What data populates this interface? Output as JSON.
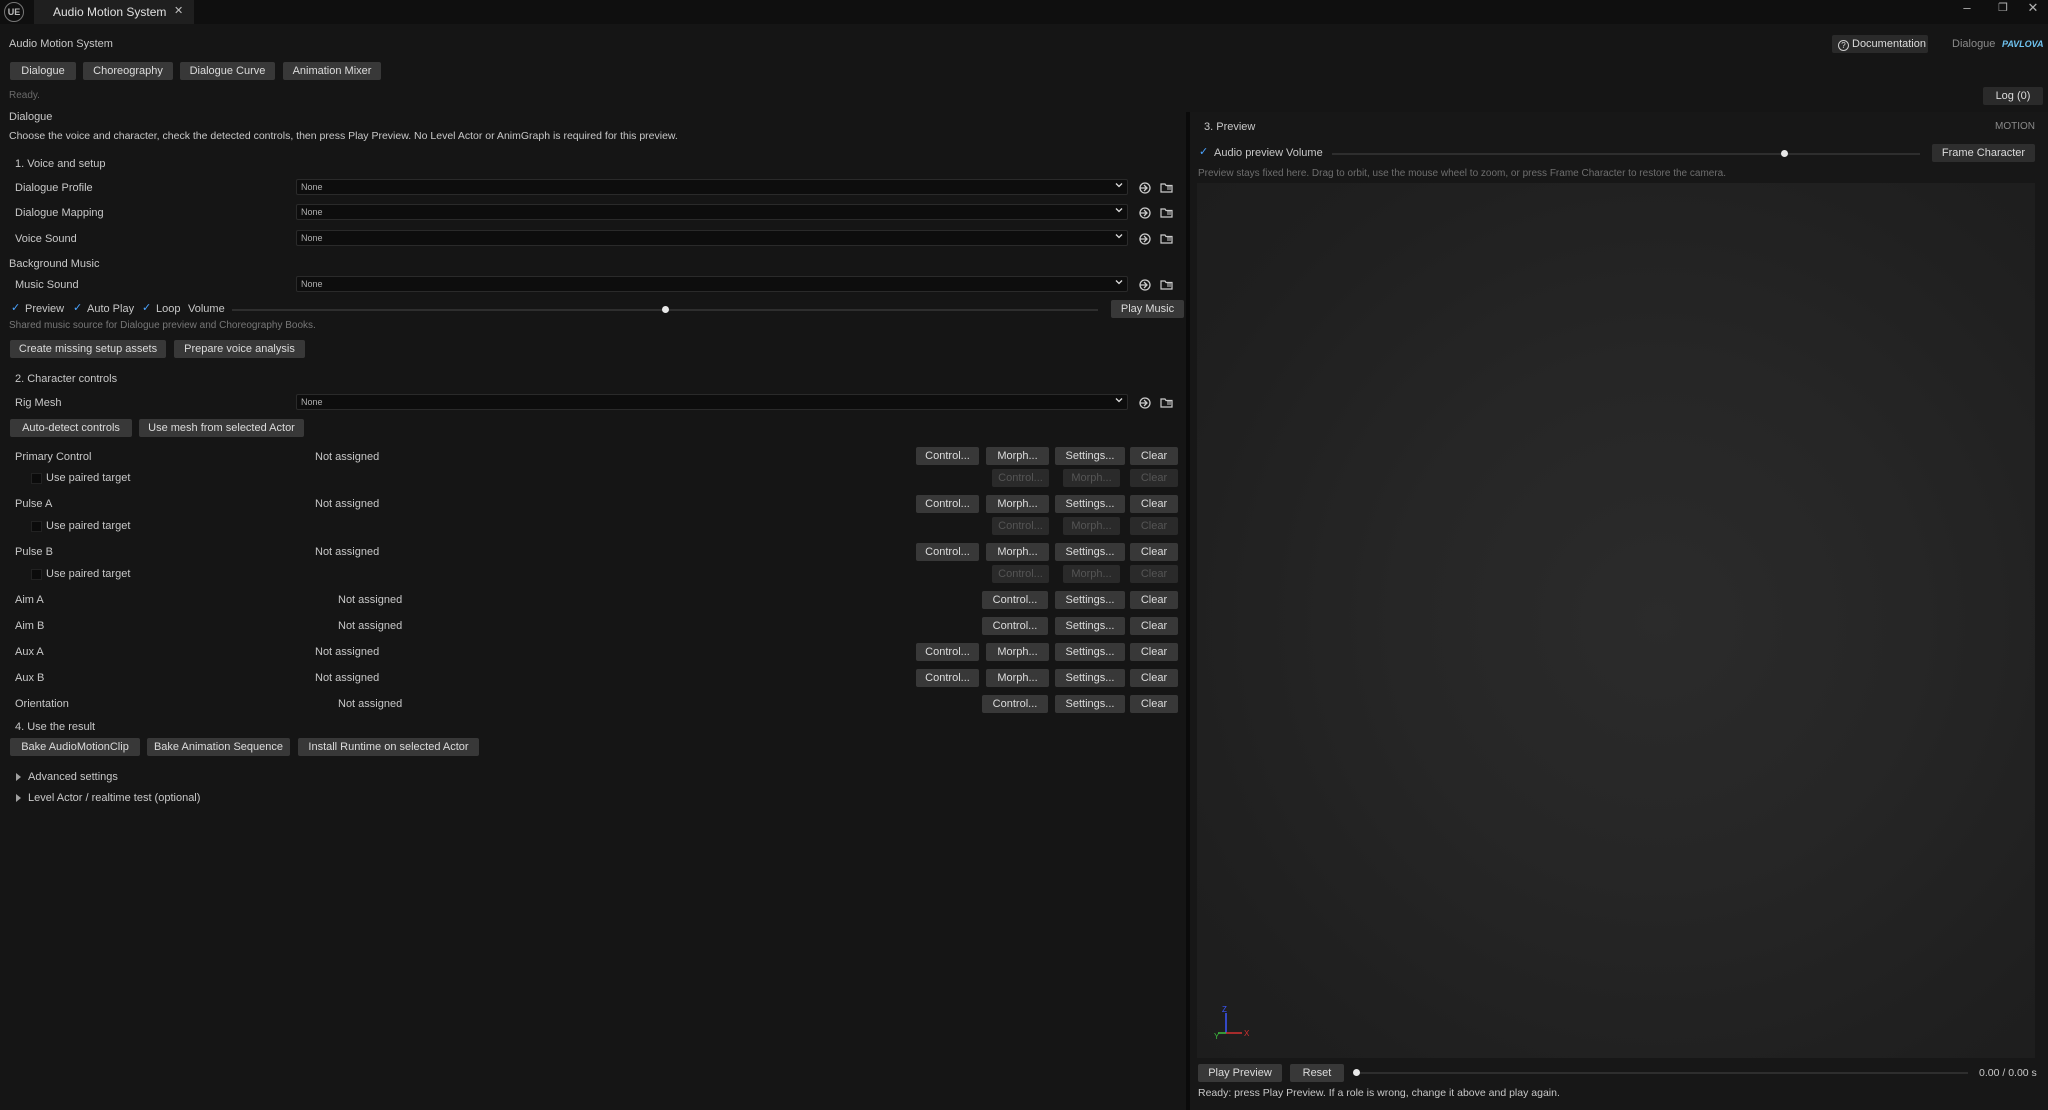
{
  "window": {
    "tab_title": "Audio Motion System",
    "close_glyph": "✕",
    "logo_text": "UE"
  },
  "header": {
    "title": "Audio Motion System",
    "documentation_label": "Documentation",
    "mode_label": "Dialogue",
    "brand_label": "PAVLOVA"
  },
  "mode_tabs": [
    "Dialogue",
    "Choreography",
    "Dialogue Curve",
    "Animation Mixer"
  ],
  "status": {
    "text": "Ready.",
    "log_label": "Log (0)"
  },
  "dialogue": {
    "heading": "Dialogue",
    "description": "Choose the voice and character, check the detected controls, then press Play Preview. No Level Actor or AnimGraph is required for this preview."
  },
  "voice_setup": {
    "heading": "1. Voice and setup",
    "rows": [
      {
        "label": "Dialogue Profile",
        "value": "None"
      },
      {
        "label": "Dialogue Mapping",
        "value": "None"
      },
      {
        "label": "Voice Sound",
        "value": "None"
      }
    ]
  },
  "background_music": {
    "heading": "Background Music",
    "music_label": "Music Sound",
    "music_value": "None",
    "preview_label": "Preview",
    "autoplay_label": "Auto Play",
    "loop_label": "Loop",
    "volume_label": "Volume",
    "volume_level": 0.5,
    "play_label": "Play Music",
    "note": "Shared music source for Dialogue preview and Choreography Books.",
    "create_assets_label": "Create missing setup assets",
    "prepare_analysis_label": "Prepare voice analysis"
  },
  "character_controls": {
    "heading": "2. Character controls",
    "rig_label": "Rig Mesh",
    "rig_value": "None",
    "autodetect_label": "Auto-detect controls",
    "use_mesh_label": "Use mesh from selected Actor",
    "paired_label": "Use paired target",
    "not_assigned": "Not assigned",
    "btn_control": "Control...",
    "btn_morph": "Morph...",
    "btn_settings": "Settings...",
    "btn_clear": "Clear",
    "btn_control_sub": "Control...",
    "btn_morph_sub": "Morph...",
    "btn_clear_sub": "Clear",
    "roles": [
      "Primary Control",
      "Pulse A",
      "Pulse B",
      "Aim A",
      "Aim B",
      "Aux A",
      "Aux B",
      "Orientation"
    ]
  },
  "use_result": {
    "heading": "4. Use the result",
    "bake_clip_label": "Bake AudioMotionClip",
    "bake_seq_label": "Bake Animation Sequence",
    "install_runtime_label": "Install Runtime on selected Actor"
  },
  "expanders": {
    "advanced_label": "Advanced settings",
    "level_actor_label": "Level Actor / realtime test (optional)"
  },
  "preview": {
    "heading": "3. Preview",
    "mode_tag": "MOTION",
    "audio_preview_label": "Audio preview",
    "volume_label": "Volume",
    "volume_level": 0.77,
    "frame_label": "Frame Character",
    "hint": "Preview stays fixed here. Drag to orbit, use the mouse wheel to zoom, or press Frame Character to restore the camera.",
    "play_label": "Play Preview",
    "reset_label": "Reset",
    "time_label": "0.00 / 0.00 s",
    "status": "Ready: press Play Preview. If a role is wrong, change it above and play again.",
    "axis_z": "Z",
    "axis_y": "Y",
    "axis_x": "X"
  },
  "colors": {
    "accent": "#d619d6",
    "check": "#4aa3ff",
    "background": "#151515",
    "button": "#383838"
  }
}
